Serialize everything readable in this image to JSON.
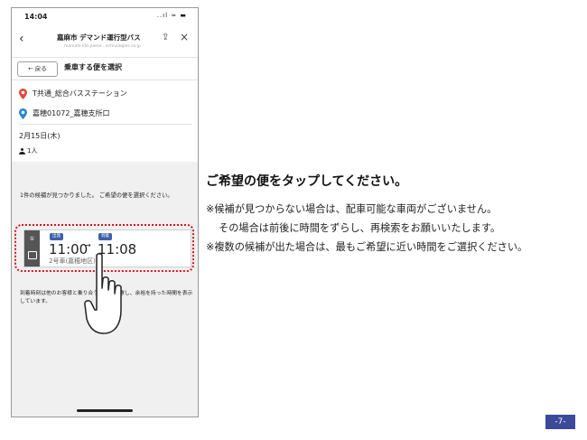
{
  "statusbar": {
    "time": "14:04",
    "icons": "..ıl ≈ ▬"
  },
  "browser": {
    "title": "嘉麻市 デマンド運行型バス",
    "url": "mamalo-life-passe...echnologies.co.jp"
  },
  "header": {
    "back_label": "← 戻る",
    "title": "乗車する便を選択"
  },
  "route": {
    "origin": "T共通_総合バスステーション",
    "destination": "嘉穂01072_嘉穂支所口",
    "origin_pin_color": "#e8453c",
    "destination_pin_color": "#2b86d8"
  },
  "trip": {
    "date": "2月15日(木)",
    "passengers": "1人"
  },
  "results": {
    "message": "1件の候補が見つかりました。 ご希望の便を選択ください。",
    "candidate": {
      "index": "①",
      "departure_tag": "出発",
      "departure_time": "11:00",
      "arrow": "→",
      "arrival_tag": "到着",
      "arrival_time": "11:08",
      "vehicle": "2号車(嘉穂地区)"
    },
    "note": "到着時刻は他のお客様と乗り合う場合を考慮し、余裕を持った時間を表示しています。"
  },
  "instruction": {
    "heading": "ご希望の便をタップしてください。",
    "lines": [
      "※候補が見つからない場合は、配車可能な車両がございません。",
      "その場合は前後に時間をずらし、再検索をお願いいたします。",
      "※複数の候補が出た場合は、最もご希望に近い時間をご選択ください。"
    ]
  },
  "page_number": "-7-",
  "colors": {
    "highlight": "#d8161d",
    "tag": "#3c61a8",
    "page_badge": "#3b4a9b"
  }
}
